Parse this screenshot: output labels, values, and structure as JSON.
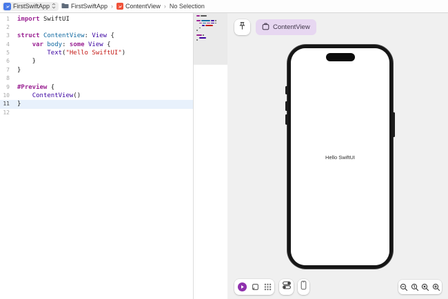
{
  "breadcrumb": {
    "target": "FirstSwiftApp",
    "project_folder": "FirstSwiftApp",
    "file": "ContentView",
    "selection": "No Selection",
    "separator": "›"
  },
  "editor": {
    "current_line": 11,
    "lines": [
      {
        "num": 1,
        "tokens": [
          {
            "t": "import ",
            "c": "kw"
          },
          {
            "t": "SwiftUI",
            "c": "plain"
          }
        ]
      },
      {
        "num": 2,
        "tokens": []
      },
      {
        "num": 3,
        "tokens": [
          {
            "t": "struct ",
            "c": "kw"
          },
          {
            "t": "ContentView",
            "c": "decl"
          },
          {
            "t": ": ",
            "c": "plain"
          },
          {
            "t": "View",
            "c": "type"
          },
          {
            "t": " {",
            "c": "plain"
          }
        ]
      },
      {
        "num": 4,
        "tokens": [
          {
            "t": "    ",
            "c": "plain"
          },
          {
            "t": "var ",
            "c": "kw"
          },
          {
            "t": "body",
            "c": "decl"
          },
          {
            "t": ": ",
            "c": "plain"
          },
          {
            "t": "some ",
            "c": "kw"
          },
          {
            "t": "View",
            "c": "type"
          },
          {
            "t": " {",
            "c": "plain"
          }
        ]
      },
      {
        "num": 5,
        "tokens": [
          {
            "t": "        ",
            "c": "plain"
          },
          {
            "t": "Text",
            "c": "type"
          },
          {
            "t": "(",
            "c": "plain"
          },
          {
            "t": "\"Hello SwiftUI\"",
            "c": "str"
          },
          {
            "t": ")",
            "c": "plain"
          }
        ]
      },
      {
        "num": 6,
        "tokens": [
          {
            "t": "    }",
            "c": "plain"
          }
        ]
      },
      {
        "num": 7,
        "tokens": [
          {
            "t": "}",
            "c": "plain"
          }
        ]
      },
      {
        "num": 8,
        "tokens": []
      },
      {
        "num": 9,
        "tokens": [
          {
            "t": "#Preview",
            "c": "kw"
          },
          {
            "t": " {",
            "c": "plain"
          }
        ]
      },
      {
        "num": 10,
        "tokens": [
          {
            "t": "    ",
            "c": "plain"
          },
          {
            "t": "ContentView",
            "c": "type"
          },
          {
            "t": "()",
            "c": "plain"
          }
        ]
      },
      {
        "num": 11,
        "tokens": [
          {
            "t": "}",
            "c": "plain"
          }
        ]
      },
      {
        "num": 12,
        "tokens": []
      }
    ]
  },
  "minimap": {
    "rows": [
      {
        "indent": 0,
        "segs": [
          {
            "w": 5,
            "c": "kw"
          },
          {
            "w": 9,
            "c": "plain"
          }
        ]
      },
      null,
      {
        "indent": 0,
        "segs": [
          {
            "w": 6,
            "c": "kw"
          },
          {
            "w": 13,
            "c": "decl"
          },
          {
            "w": 5,
            "c": "type"
          },
          {
            "w": 2,
            "c": "plain"
          }
        ]
      },
      {
        "indent": 4,
        "segs": [
          {
            "w": 4,
            "c": "kw"
          },
          {
            "w": 5,
            "c": "decl"
          },
          {
            "w": 5,
            "c": "kw"
          },
          {
            "w": 5,
            "c": "type"
          },
          {
            "w": 2,
            "c": "plain"
          }
        ]
      },
      {
        "indent": 8,
        "segs": [
          {
            "w": 4,
            "c": "type"
          },
          {
            "w": 11,
            "c": "str"
          }
        ]
      },
      {
        "indent": 4,
        "segs": [
          {
            "w": 2,
            "c": "plain"
          }
        ]
      },
      {
        "indent": 0,
        "segs": [
          {
            "w": 2,
            "c": "plain"
          }
        ]
      },
      null,
      {
        "indent": 0,
        "segs": [
          {
            "w": 8,
            "c": "kw"
          },
          {
            "w": 2,
            "c": "plain"
          }
        ]
      },
      {
        "indent": 4,
        "segs": [
          {
            "w": 10,
            "c": "type"
          }
        ]
      },
      {
        "indent": 0,
        "segs": [
          {
            "w": 2,
            "c": "plain"
          }
        ]
      },
      null
    ]
  },
  "canvas": {
    "preview_tab": "ContentView",
    "preview_text": "Hello SwiftUI"
  },
  "icons": {
    "app_target": "blue-app-target",
    "folder": "folder",
    "swift_file": "swift-bird",
    "target_chevrons": "up-down-chevrons",
    "pin": "pushpin",
    "preview_tab": "canvas-frame",
    "live_mode": "play",
    "selectable_mode": "select-rect",
    "variants_mode": "grid",
    "device_settings": "toggles",
    "device_picker": "iphone",
    "zoom_out": "magnifier-minus",
    "zoom_100": "magnifier-1",
    "zoom_fit": "magnifier-fit",
    "zoom_in": "magnifier-plus"
  },
  "colors": {
    "kw": "#9B2393",
    "type": "#3900A0",
    "decl": "#0F68A0",
    "str": "#C41A16",
    "plain": "#1f1f1f",
    "linenum": "#a8a8a8",
    "currentline": "#e8f1fc",
    "tabbg": "#e7d7f1",
    "tabfg": "#40364a",
    "playbtn": "#8f31ad",
    "canvasbg": "#f0f0f0",
    "phoneblack": "#161616",
    "icon": "#3e3e3e"
  }
}
